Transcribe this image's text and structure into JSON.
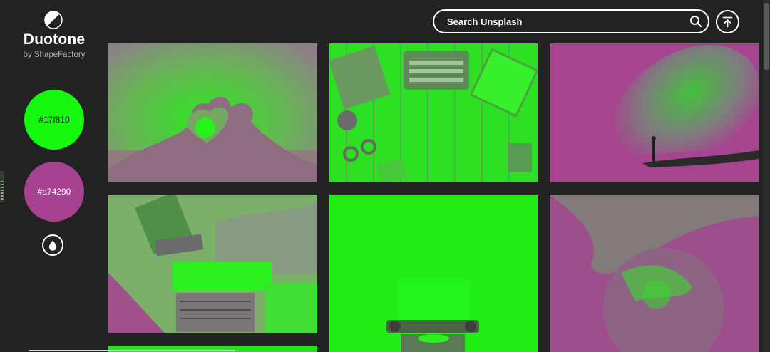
{
  "brand": {
    "title": "Duotone",
    "subtitle": "by ShapeFactory",
    "logo_icon": "half-circle-icon"
  },
  "palette": {
    "primary": {
      "label": "#17f810",
      "color": "#17f810"
    },
    "secondary": {
      "label": "#a74290",
      "color": "#a74290"
    },
    "drop_icon": "droplet-icon"
  },
  "header": {
    "search": {
      "placeholder": "Search Unsplash",
      "value": "",
      "icon": "search-icon"
    },
    "top_button_icon": "arrow-up-to-top-icon"
  },
  "gallery": {
    "photos": [
      {
        "subject": "heart-hands"
      },
      {
        "subject": "typewriter-desk"
      },
      {
        "subject": "night-sky-silhouette"
      },
      {
        "subject": "laptop-writing"
      },
      {
        "subject": "typewriter-paper"
      },
      {
        "subject": "planet-space"
      },
      {
        "subject": "partial-bottom"
      }
    ]
  }
}
